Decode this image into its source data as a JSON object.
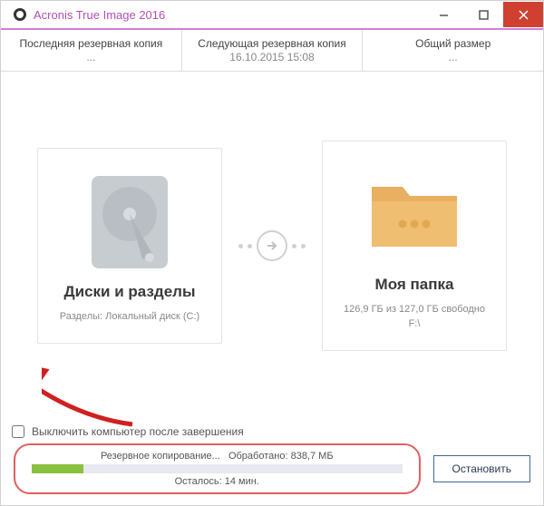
{
  "window": {
    "title": "Acronis True Image 2016"
  },
  "info": {
    "last": {
      "label": "Последняя резервная копия",
      "value": "..."
    },
    "next": {
      "label": "Следующая резервная копия",
      "value": "16.10.2015 15:08"
    },
    "size": {
      "label": "Общий размер",
      "value": "..."
    }
  },
  "source": {
    "title": "Диски и разделы",
    "subtitle": "Разделы: Локальный диск (C:)"
  },
  "dest": {
    "title": "Моя папка",
    "subtitle": "126,9 ГБ из 127,0 ГБ свободно\nF:\\"
  },
  "shutdown": {
    "label": "Выключить компьютер после завершения"
  },
  "progress": {
    "status_prefix": "Резервное копирование...",
    "processed_label": "Обработано:",
    "processed_value": "838,7 МБ",
    "remaining_label": "Осталось:",
    "remaining_value": "14 мин.",
    "percent": 14
  },
  "buttons": {
    "stop": "Остановить"
  }
}
